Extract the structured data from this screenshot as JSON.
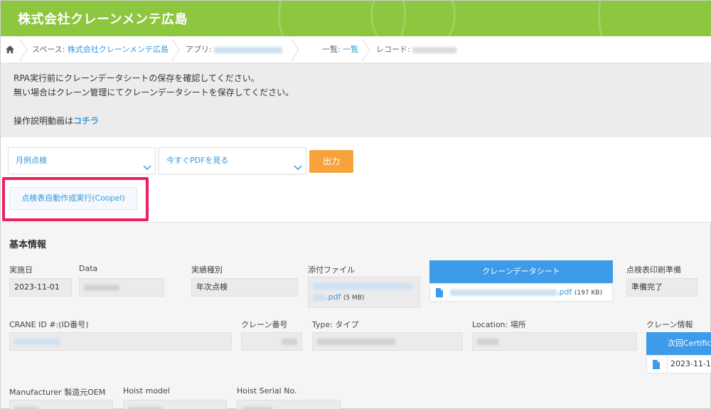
{
  "header": {
    "title": "株式会社クレーンメンテ広島"
  },
  "breadcrumb": {
    "space_prefix": "スペース:",
    "space_link": "株式会社クレーンメンテ広島",
    "app_prefix": "アプリ:",
    "list_prefix": "一覧:",
    "list_link": "一覧",
    "record_prefix": "レコード:"
  },
  "notice": {
    "line1": "RPA実行前にクレーンデータシートの保存を確認してください。",
    "line2": "無い場合はクレーン管理にてクレーンデータシートを保存してください。",
    "line3_prefix": "操作説明動画は",
    "line3_link": "コチラ"
  },
  "toolbar": {
    "select1_value": "月例点検",
    "select2_value": "今すぐPDFを見る",
    "output_button": "出力",
    "run_button": "点検表自動作成実行(Coopel)"
  },
  "form": {
    "section_title": "基本情報",
    "implementation_date_label": "実施日",
    "implementation_date_value": "2023-11-01",
    "data_label": "Data",
    "result_type_label": "実績種別",
    "result_type_value": "年次点検",
    "attachment_label": "添付ファイル",
    "attachment_ext": ".pdf",
    "attachment_size": "(5 MB)",
    "crane_datasheet_header": "クレーンデータシート",
    "crane_datasheet_ext": ".pdf",
    "crane_datasheet_size": "(197 KB)",
    "print_prep_label": "点検表印刷準備",
    "print_prep_value": "準備完了",
    "crane_id_label": "CRANE ID #:(ID番号)",
    "crane_number_label": "クレーン番号",
    "type_label": "Type: タイプ",
    "location_label": "Location: 場所",
    "crane_info_label": "クレーン情報",
    "next_cert_header": "次回Certifica",
    "next_cert_value": "2023-11-1",
    "manufacturer_label": "Manufacturer 製造元OEM",
    "hoist_model_label": "Hoist model",
    "hoist_serial_label": "Hoist Serial No."
  },
  "colors": {
    "header_green": "#8dc63f",
    "link_blue": "#3498db",
    "output_orange": "#f7a23a",
    "highlight_pink": "#ee1f5f",
    "table_header_blue": "#3d9be9"
  }
}
